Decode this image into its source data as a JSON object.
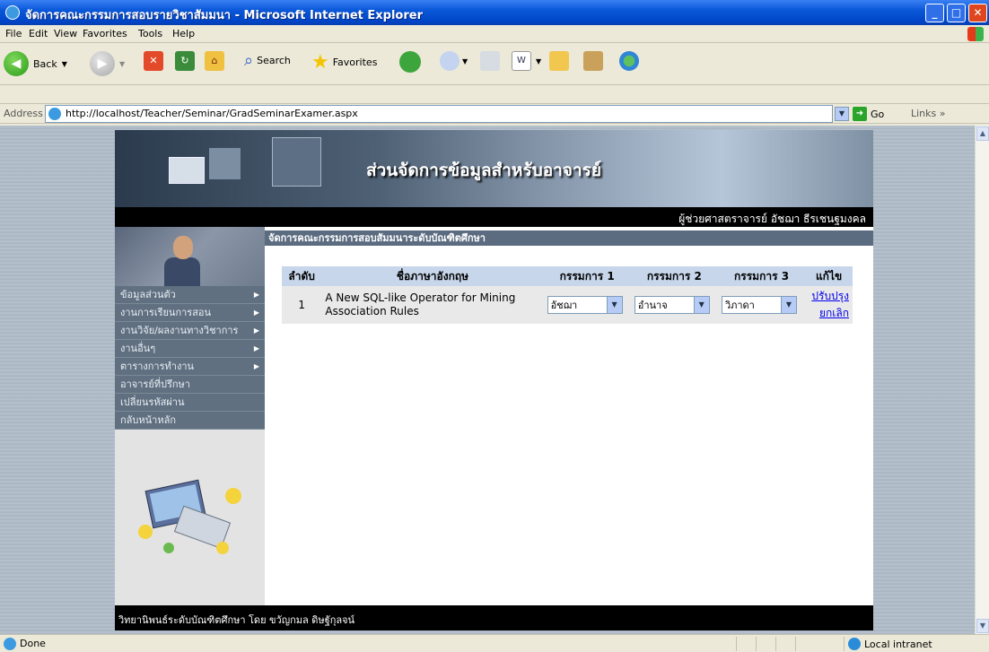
{
  "window": {
    "title": "จัดการคณะกรรมการสอบรายวิชาสัมมนา - Microsoft Internet Explorer",
    "min": "_",
    "max": "□",
    "close": "✕"
  },
  "menubar": [
    "File",
    "Edit",
    "View",
    "Favorites",
    "Tools",
    "Help"
  ],
  "toolbar": {
    "back": "Back",
    "search": "Search",
    "favorites": "Favorites"
  },
  "address": {
    "label": "Address",
    "url": "http://localhost/Teacher/Seminar/GradSeminarExamer.aspx",
    "go": "Go",
    "links": "Links"
  },
  "page": {
    "banner_title": "ส่วนจัดการข้อมูลสำหรับอาจารย์",
    "author": "ผู้ช่วยศาสตราจารย์ อัชฌา ธีรเชนฐมงคล",
    "section_title": "จัดการคณะกรรมการสอบสัมมนาระดับบัณฑิตศึกษา",
    "footer": "วิทยานิพนธ์ระดับบัณฑิตศึกษา โดย ขวัญกมล ดิษฐักุลจน์"
  },
  "sidebar": {
    "items": [
      {
        "label": "ข้อมูลส่วนตัว",
        "arrow": true
      },
      {
        "label": "งานการเรียนการสอน",
        "arrow": true
      },
      {
        "label": "งานวิจัย/ผลงานทางวิชาการ",
        "arrow": true
      },
      {
        "label": "งานอื่นๆ",
        "arrow": true
      },
      {
        "label": "ตารางการทำงาน",
        "arrow": true
      },
      {
        "label": "อาจารย์ที่ปรึกษา",
        "arrow": false
      },
      {
        "label": "เปลี่ยนรหัสผ่าน",
        "arrow": false
      },
      {
        "label": "กลับหน้าหลัก",
        "arrow": false
      }
    ]
  },
  "table": {
    "headers": [
      "ลำดับ",
      "ชื่อภาษาอังกฤษ",
      "กรรมการ 1",
      "กรรมการ 2",
      "กรรมการ 3",
      "แก้ไข"
    ],
    "rows": [
      {
        "no": "1",
        "name": "A New SQL-like Operator for Mining Association Rules",
        "c1": "อัชฌา",
        "c2": "อำนาจ",
        "c3": "วิภาดา",
        "update": "ปรับปรุง",
        "cancel": "ยกเลิก"
      }
    ]
  },
  "status": {
    "text": "Done",
    "zone": "Local intranet"
  }
}
